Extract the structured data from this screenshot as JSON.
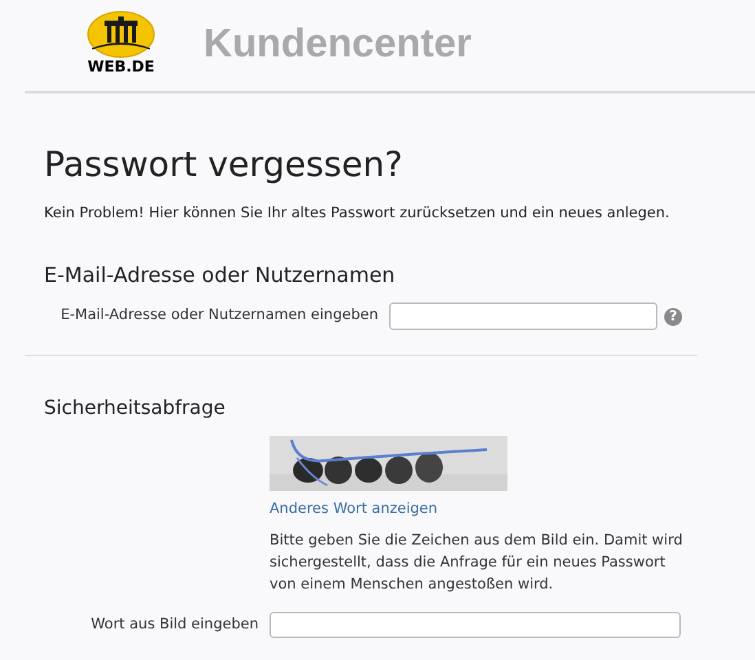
{
  "header": {
    "logo_text": "WEB.DE",
    "title": "Kundencenter"
  },
  "page_title": "Passwort vergessen?",
  "intro": "Kein Problem! Hier können Sie Ihr altes Passwort zurücksetzen und ein neues anlegen.",
  "account_section": {
    "heading": "E-Mail-Adresse oder Nutzernamen",
    "field_label": "E-Mail-Adresse oder Nutzernamen eingeben",
    "help_icon": "?"
  },
  "security_section": {
    "heading": "Sicherheitsabfrage",
    "link": "Anderes Wort anzeigen",
    "hint": "Bitte geben Sie die Zeichen aus dem Bild ein. Damit wird sichergestellt, dass die Anfrage für ein neues Passwort von einem Menschen angestoßen wird.",
    "field_label": "Wort aus Bild eingeben"
  }
}
